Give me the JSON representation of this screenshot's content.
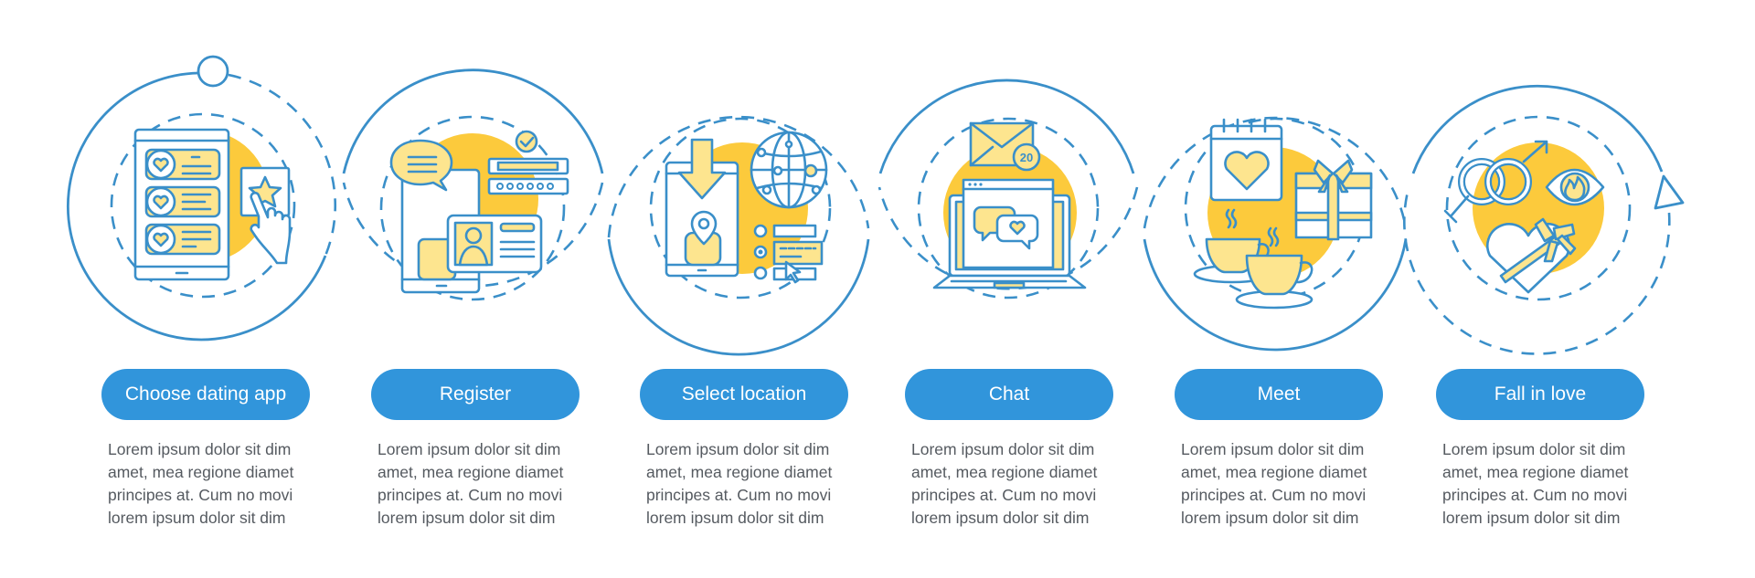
{
  "colors": {
    "accent_blue": "#3195db",
    "line_blue": "#3a8fc9",
    "yellow": "#fcca3c",
    "light_yellow": "#fde58f",
    "body_text": "#555a60"
  },
  "steps": [
    {
      "label": "Choose dating app",
      "icon": "dating-app-phone-icon",
      "description": "Lorem ipsum dolor sit dim\namet, mea regione diamet\nprincipes at. Cum no movi\nlorem ipsum dolor sit dim"
    },
    {
      "label": "Register",
      "icon": "registration-profile-icon",
      "description": "Lorem ipsum dolor sit dim\namet, mea regione diamet\nprincipes at. Cum no movi\nlorem ipsum dolor sit dim"
    },
    {
      "label": "Select location",
      "icon": "location-globe-icon",
      "description": "Lorem ipsum dolor sit dim\namet, mea regione diamet\nprincipes at. Cum no movi\nlorem ipsum dolor sit dim"
    },
    {
      "label": "Chat",
      "icon": "laptop-chat-icon",
      "badge": "20",
      "description": "Lorem ipsum dolor sit dim\namet, mea regione diamet\nprincipes at. Cum no movi\nlorem ipsum dolor sit dim"
    },
    {
      "label": "Meet",
      "icon": "date-coffee-gift-icon",
      "description": "Lorem ipsum dolor sit dim\namet, mea regione diamet\nprincipes at. Cum no movi\nlorem ipsum dolor sit dim"
    },
    {
      "label": "Fall in love",
      "icon": "rings-heart-icon",
      "description": "Lorem ipsum dolor sit dim\namet, mea regione diamet\nprincipes at. Cum no movi\nlorem ipsum dolor sit dim"
    }
  ]
}
